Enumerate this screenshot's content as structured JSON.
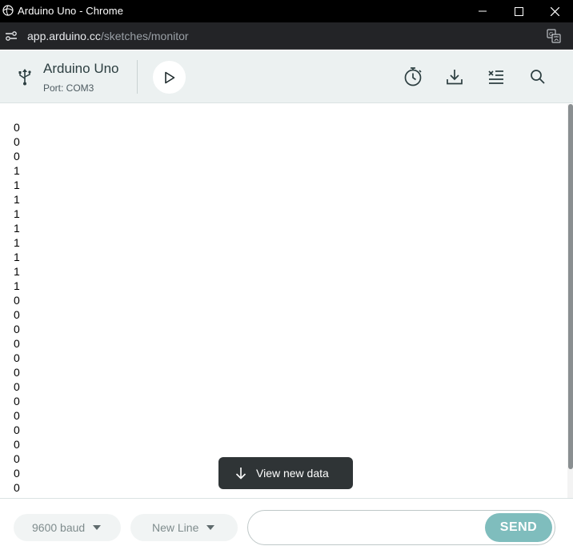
{
  "window": {
    "title": "Arduino Uno - Chrome"
  },
  "address": {
    "domain": "app.arduino.cc",
    "path": "/sketches/monitor"
  },
  "board": {
    "name": "Arduino Uno",
    "port": "Port: COM3"
  },
  "monitor": {
    "lines": [
      "0",
      "0",
      "0",
      "1",
      "1",
      "1",
      "1",
      "1",
      "1",
      "1",
      "1",
      "1",
      "0",
      "0",
      "0",
      "0",
      "0",
      "0",
      "0",
      "0",
      "0",
      "0",
      "0",
      "0",
      "0",
      "0"
    ],
    "view_new_data_label": "View new data"
  },
  "footer": {
    "baud_label": "9600 baud",
    "line_ending_label": "New Line",
    "message_value": "",
    "send_label": "SEND"
  },
  "colors": {
    "toolbar_bg": "#ecf1f1",
    "send_button": "#7fbdbd",
    "toast_bg": "#2f3436"
  },
  "icons": {
    "usb": "usb-icon",
    "play": "play-icon",
    "timestamp": "stopwatch-icon",
    "download": "download-icon",
    "clear": "clear-output-icon",
    "search": "search-icon"
  }
}
